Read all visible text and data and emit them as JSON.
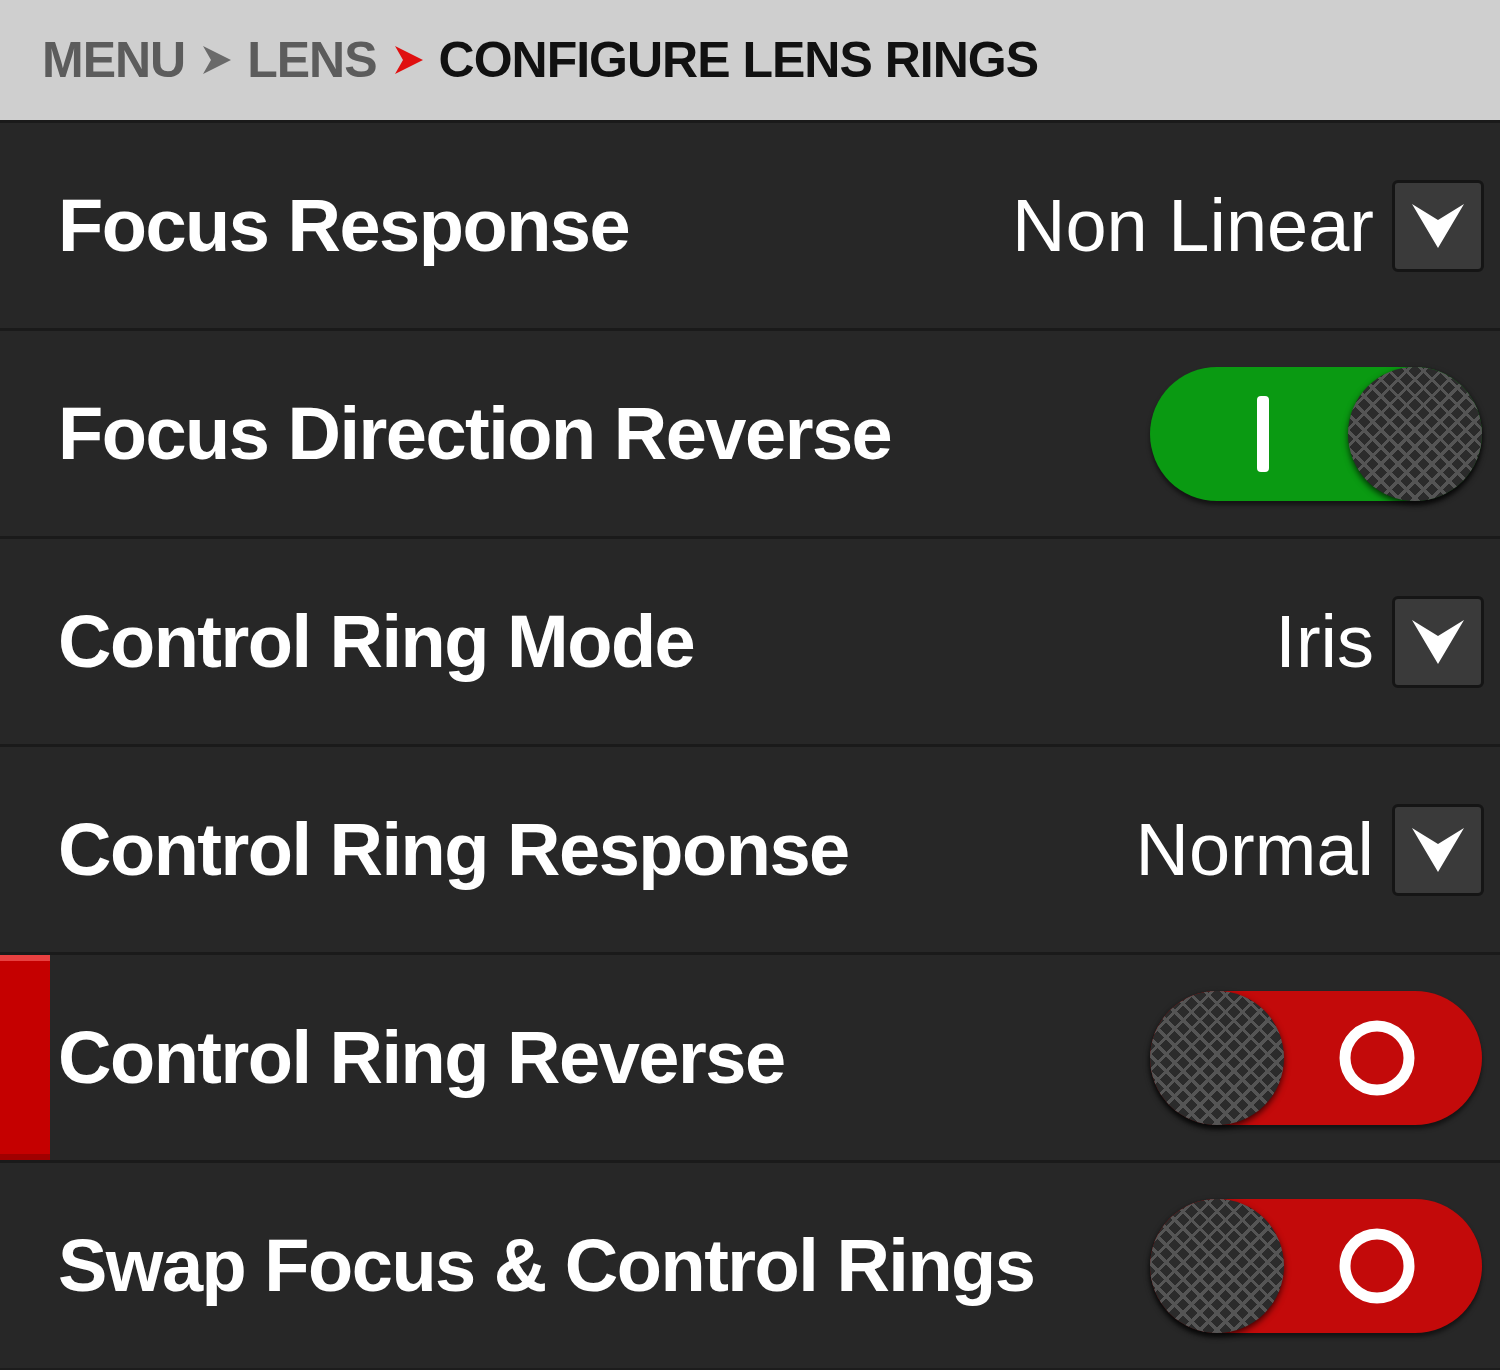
{
  "breadcrumb": [
    {
      "label": "MENU",
      "current": false
    },
    {
      "label": "LENS",
      "current": false
    },
    {
      "label": "CONFIGURE LENS RINGS",
      "current": true
    }
  ],
  "rows": [
    {
      "kind": "dropdown",
      "label": "Focus Response",
      "value": "Non Linear",
      "selected": false
    },
    {
      "kind": "toggle",
      "label": "Focus Direction Reverse",
      "on": true,
      "selected": false
    },
    {
      "kind": "dropdown",
      "label": "Control Ring Mode",
      "value": "Iris",
      "selected": false
    },
    {
      "kind": "dropdown",
      "label": "Control Ring Response",
      "value": "Normal",
      "selected": false
    },
    {
      "kind": "toggle",
      "label": "Control Ring Reverse",
      "on": false,
      "selected": true
    },
    {
      "kind": "toggle",
      "label": "Swap Focus & Control Rings",
      "on": false,
      "selected": false
    }
  ]
}
